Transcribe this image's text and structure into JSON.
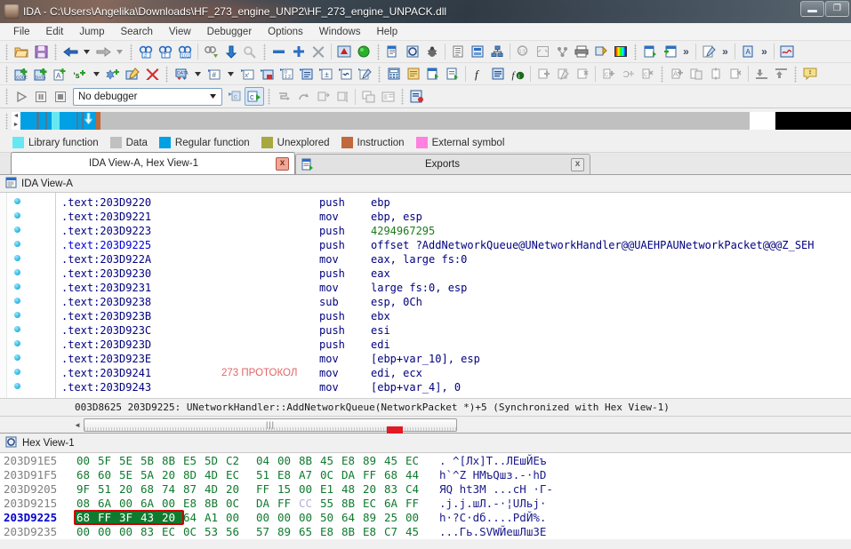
{
  "window": {
    "title": "IDA - C:\\Users\\Angelika\\Downloads\\HF_273_engine_UNP2\\HF_273_engine_UNPACK.dll",
    "minimize_label": "Minimize",
    "restore_label": "Restore",
    "app_icon_name": "ida-app-icon"
  },
  "menu": {
    "items": [
      "File",
      "Edit",
      "Jump",
      "Search",
      "View",
      "Debugger",
      "Options",
      "Windows",
      "Help"
    ]
  },
  "debugger_bar": {
    "run_label": "Run",
    "pause_label": "Pause",
    "stop_label": "Stop",
    "selected_debugger": "No debugger"
  },
  "navigation": {
    "legend": [
      {
        "label": "Library function",
        "color": "#66e8f2"
      },
      {
        "label": "Data",
        "color": "#c0c0c0"
      },
      {
        "label": "Regular function",
        "color": "#00a0e4"
      },
      {
        "label": "Unexplored",
        "color": "#a8a840"
      },
      {
        "label": "Instruction",
        "color": "#c0693b"
      },
      {
        "label": "External symbol",
        "color": "#ff80e0"
      }
    ]
  },
  "tabs": [
    {
      "label": "IDA View-A, Hex View-1",
      "active": true,
      "close_label": "x"
    },
    {
      "label": "Exports",
      "active": false,
      "close_label": "x"
    }
  ],
  "ida_view": {
    "header_title": "IDA View-A",
    "lines": [
      {
        "addr": ".text:203D9220",
        "comment": "",
        "mnemonic": "push",
        "operands": "ebp",
        "current": false
      },
      {
        "addr": ".text:203D9221",
        "comment": "",
        "mnemonic": "mov",
        "operands": "ebp, esp",
        "current": false
      },
      {
        "addr": ".text:203D9223",
        "comment": "",
        "mnemonic": "push",
        "operands": "4294967295",
        "current": false,
        "operand_numeric": true
      },
      {
        "addr": ".text:203D9225",
        "comment": "",
        "mnemonic": "push",
        "operands": "offset ?AddNetworkQueue@UNetworkHandler@@UAEHPAUNetworkPacket@@@Z_SEH",
        "current": true
      },
      {
        "addr": ".text:203D922A",
        "comment": "",
        "mnemonic": "mov",
        "operands": "eax, large fs:0",
        "current": false
      },
      {
        "addr": ".text:203D9230",
        "comment": "",
        "mnemonic": "push",
        "operands": "eax",
        "current": false
      },
      {
        "addr": ".text:203D9231",
        "comment": "",
        "mnemonic": "mov",
        "operands": "large fs:0, esp",
        "current": false
      },
      {
        "addr": ".text:203D9238",
        "comment": "",
        "mnemonic": "sub",
        "operands": "esp, 0Ch",
        "current": false
      },
      {
        "addr": ".text:203D923B",
        "comment": "",
        "mnemonic": "push",
        "operands": "ebx",
        "current": false
      },
      {
        "addr": ".text:203D923C",
        "comment": "",
        "mnemonic": "push",
        "operands": "esi",
        "current": false
      },
      {
        "addr": ".text:203D923D",
        "comment": "",
        "mnemonic": "push",
        "operands": "edi",
        "current": false
      },
      {
        "addr": ".text:203D923E",
        "comment": "",
        "mnemonic": "mov",
        "operands": "[ebp+var_10], esp",
        "current": false
      },
      {
        "addr": ".text:203D9241",
        "comment": "273 ПРОТОКОЛ",
        "mnemonic": "mov",
        "operands": "edi, ecx",
        "current": false
      },
      {
        "addr": ".text:203D9243",
        "comment": "",
        "mnemonic": "mov",
        "operands": "[ebp+var_4], 0",
        "current": false
      }
    ],
    "status": "003D8625 203D9225: UNetworkHandler::AddNetworkQueue(NetworkPacket *)+5 (Synchronized with Hex View-1)"
  },
  "hex_view": {
    "header_title": "Hex View-1",
    "rows": [
      {
        "addr": "203D91E5",
        "bytes": [
          "00",
          "5F",
          "5E",
          "5B",
          "8B",
          "E5",
          "5D",
          "C2",
          "04",
          "00",
          "8B",
          "45",
          "E8",
          "89",
          "45",
          "EC"
        ],
        "ascii": ". ^[Лx]T..ЛEшЙEъ",
        "current": false
      },
      {
        "addr": "203D91F5",
        "bytes": [
          "68",
          "60",
          "5E",
          "5A",
          "20",
          "8D",
          "4D",
          "EC",
          "51",
          "E8",
          "A7",
          "0C",
          "DA",
          "FF",
          "68",
          "44"
        ],
        "ascii": "h`^Z HMъQшз.-·hD",
        "current": false
      },
      {
        "addr": "203D9205",
        "bytes": [
          "9F",
          "51",
          "20",
          "68",
          "74",
          "87",
          "4D",
          "20",
          "FF",
          "15",
          "00",
          "E1",
          "48",
          "20",
          "83",
          "C4"
        ],
        "ascii": "ЯQ htЗM ...cH ·Г-",
        "current": false
      },
      {
        "addr": "203D9215",
        "bytes": [
          "08",
          "6A",
          "00",
          "6A",
          "00",
          "E8",
          "8B",
          "0C",
          "DA",
          "FF",
          "CC",
          "55",
          "8B",
          "EC",
          "6A",
          "FF"
        ],
        "ascii": ".j.j.шЛ.-·¦UЛьj·",
        "current": false
      },
      {
        "addr": "203D9225",
        "bytes": [
          "68",
          "FF",
          "3F",
          "43",
          "20",
          "64",
          "A1",
          "00",
          "00",
          "00",
          "00",
          "50",
          "64",
          "89",
          "25",
          "00"
        ],
        "ascii": "h·?C·dб....PdЙ%.",
        "current": true,
        "selection": {
          "start": 0,
          "end": 5
        }
      },
      {
        "addr": "203D9235",
        "bytes": [
          "00",
          "00",
          "00",
          "83",
          "EC",
          "0C",
          "53",
          "56",
          "57",
          "89",
          "65",
          "E8",
          "8B",
          "E8",
          "C7",
          "45"
        ],
        "ascii": "...Гь.SVWЙeшЛшЗE",
        "current": false
      }
    ]
  },
  "scrollbar": {
    "left_arrow": "◄",
    "grip": "|||"
  }
}
